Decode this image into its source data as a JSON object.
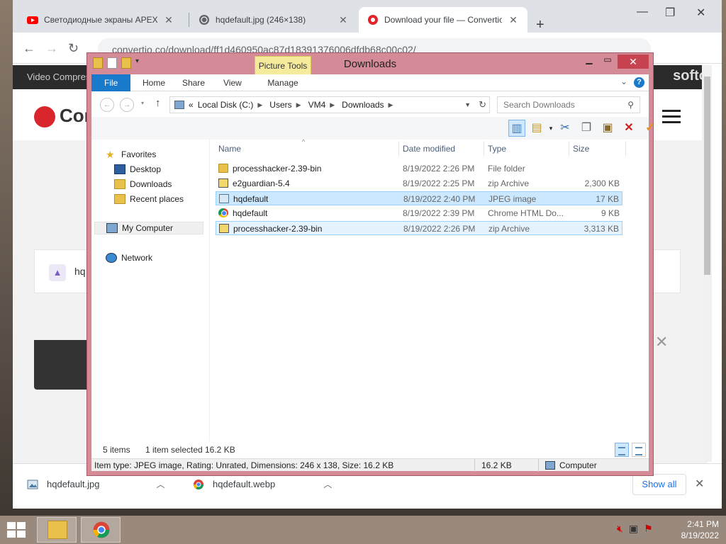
{
  "browser": {
    "tabs": [
      {
        "label": "Светодиодные экраны APEX-LED",
        "favicon": "youtube-icon",
        "active": false
      },
      {
        "label": "hqdefault.jpg (246×138)",
        "favicon": "globe-icon",
        "active": false
      },
      {
        "label": "Download your file — Convertio",
        "favicon": "convertio-icon",
        "active": true
      }
    ],
    "url": "convertio.co/download/ff1d460950ac87d18391376006dfdb68c00c02/",
    "site": {
      "strip_left": "Video Compres",
      "strip_right": "softo",
      "logo_text": "Con",
      "file_name": "hq"
    },
    "downloads": [
      {
        "name": "hqdefault.jpg",
        "icon": "image-file-icon"
      },
      {
        "name": "hqdefault.webp",
        "icon": "chrome-icon"
      }
    ],
    "show_all": "Show all"
  },
  "explorer": {
    "title": "Downloads",
    "context_tab": "Picture Tools",
    "ribbon_tabs": [
      "File",
      "Home",
      "Share",
      "View",
      "Manage"
    ],
    "breadcrumb": [
      "Local Disk (C:)",
      "Users",
      "VM4",
      "Downloads"
    ],
    "breadcrumb_prefix": "«",
    "search_placeholder": "Search Downloads",
    "nav": {
      "favorites": "Favorites",
      "desktop": "Desktop",
      "downloads": "Downloads",
      "recent": "Recent places",
      "computer": "My Computer",
      "network": "Network"
    },
    "columns": {
      "name": "Name",
      "date": "Date modified",
      "type": "Type",
      "size": "Size"
    },
    "files": [
      {
        "name": "processhacker-2.39-bin",
        "date": "8/19/2022 2:26 PM",
        "type": "File folder",
        "size": "",
        "icon": "folder-icon"
      },
      {
        "name": "e2guardian-5.4",
        "date": "8/19/2022 2:25 PM",
        "type": "zip Archive",
        "size": "2,300 KB",
        "icon": "zip-icon"
      },
      {
        "name": "hqdefault",
        "date": "8/19/2022 2:40 PM",
        "type": "JPEG image",
        "size": "17 KB",
        "icon": "jpeg-icon"
      },
      {
        "name": "hqdefault",
        "date": "8/19/2022 2:39 PM",
        "type": "Chrome HTML Do...",
        "size": "9 KB",
        "icon": "chrome-icon"
      },
      {
        "name": "processhacker-2.39-bin",
        "date": "8/19/2022 2:26 PM",
        "type": "zip Archive",
        "size": "3,313 KB",
        "icon": "zip-icon"
      }
    ],
    "status": {
      "items": "5 items",
      "selected": "1 item selected",
      "selected_size": "16.2 KB"
    },
    "details": {
      "info": "Item type: JPEG image, Rating: Unrated, Dimensions: 246 x 138, Size: 16.2 KB",
      "size": "16.2 KB",
      "location": "Computer"
    }
  },
  "taskbar": {
    "time": "2:41 PM",
    "date": "8/19/2022"
  }
}
